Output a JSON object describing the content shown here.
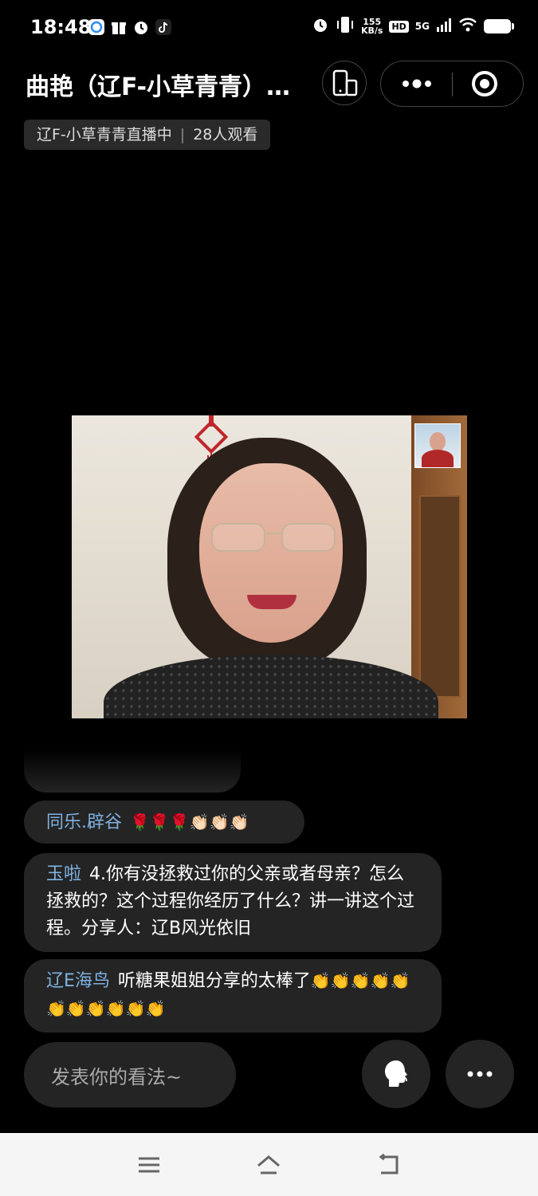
{
  "status_bar": {
    "time": "18:48",
    "left_icons": [
      "chat-app-icon",
      "gift-icon",
      "alarm-icon",
      "tiktok-icon"
    ],
    "net_speed_value": "155",
    "net_speed_unit": "KB/s",
    "hd": "HD",
    "network": "5G",
    "right_icons": [
      "alarm-icon",
      "vibrate-icon",
      "signal-icon",
      "wifi-icon",
      "battery-icon"
    ]
  },
  "header": {
    "title": "曲艳（辽F-小草青青）…"
  },
  "live_info": {
    "status": "辽F-小草青青直播中",
    "separator": "|",
    "viewers": "28人观看"
  },
  "comments": [
    {
      "user": "同乐.辟谷",
      "text": "",
      "emoji": "🌹🌹🌹👏🏻👏🏻👏🏻"
    },
    {
      "user": "玉啦",
      "text": "4.你有没拯救过你的父亲或者母亲？怎么拯救的？这个过程你经历了什么？讲一讲这个过程。分享人：辽B风光依旧",
      "emoji": ""
    },
    {
      "user": "辽E海鸟",
      "text": "听糖果姐姐分享的太棒了",
      "emoji": "👏👏👏👏👏👏👏👏👏👏👏"
    }
  ],
  "comment_input": {
    "placeholder": "发表你的看法~"
  },
  "colors": {
    "background": "#000000",
    "bubble": "#242424",
    "username": "#7fb2e0",
    "nav_bar": "#f5f5f5"
  }
}
